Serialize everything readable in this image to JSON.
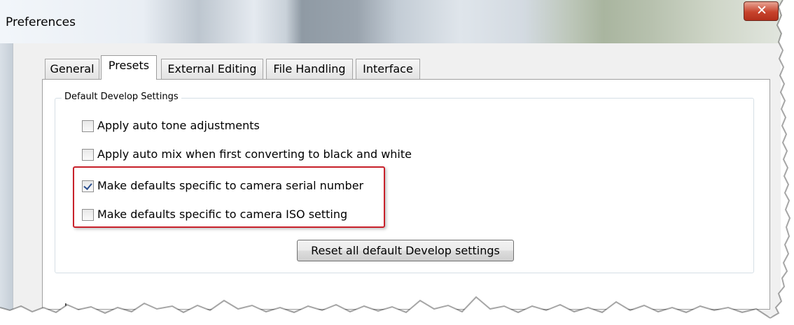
{
  "window": {
    "title": "Preferences",
    "close_glyph": "✕",
    "close_icon": "close-icon"
  },
  "tabs": [
    {
      "label": "General",
      "active": false
    },
    {
      "label": "Presets",
      "active": true
    },
    {
      "label": "External Editing",
      "active": false
    },
    {
      "label": "File Handling",
      "active": false
    },
    {
      "label": "Interface",
      "active": false
    }
  ],
  "default_develop": {
    "group_label": "Default Develop Settings",
    "options": [
      {
        "label": "Apply auto tone adjustments",
        "checked": false
      },
      {
        "label": "Apply auto mix when first converting to black and white",
        "checked": false
      },
      {
        "label": "Make defaults specific to camera serial number",
        "checked": true
      },
      {
        "label": "Make defaults specific to camera ISO setting",
        "checked": false
      }
    ],
    "reset_button": "Reset all default Develop settings"
  },
  "next_group": {
    "label_partial": "L"
  },
  "colors": {
    "highlight": "#c8202a",
    "checkmark": "#2b4f8f"
  }
}
